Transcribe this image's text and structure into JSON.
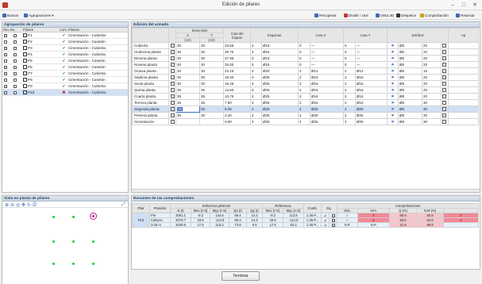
{
  "window": {
    "title": "Edición de pilares",
    "min": "–",
    "max": "□",
    "close": "✕"
  },
  "toolbar": {
    "left": [
      {
        "label": "Buscar",
        "icon": "binoculars-icon",
        "color": "#3d6bb3"
      },
      {
        "label": "Agrupaciones ▾",
        "icon": "group-icon",
        "color": "#3d6bb3"
      }
    ],
    "right": [
      {
        "label": "Recuperar",
        "icon": "undo-icon",
        "color": "#3d6bb3"
      },
      {
        "label": "Dividir / Unir",
        "icon": "split-icon",
        "color": "#c0392b"
      },
      {
        "label": "Vista 3D",
        "icon": "cube-icon",
        "color": "#3d6bb3"
      },
      {
        "label": "Despiece",
        "icon": "grid-icon",
        "color": "#333333"
      },
      {
        "label": "Comprobación",
        "icon": "check-icon",
        "color": "#d4a017"
      },
      {
        "label": "Rearmar",
        "icon": "wrench-icon",
        "color": "#3d6bb3"
      }
    ]
  },
  "groups": {
    "title": "Agrupación de pilares",
    "headers": [
      "Rev.",
      "Bo.",
      "Pilares",
      "Com.",
      "Plantas"
    ],
    "rows": [
      {
        "name": "P1",
        "status": "ok",
        "plantas": "Cimentación - Cubierta"
      },
      {
        "name": "P2",
        "status": "ok",
        "plantas": "Cimentación - Casetón"
      },
      {
        "name": "P3",
        "status": "ok",
        "plantas": "Cimentación - Cubierta"
      },
      {
        "name": "P4",
        "status": "ok",
        "plantas": "Cimentación - Cubierta"
      },
      {
        "name": "P5",
        "status": "ok",
        "plantas": "Cimentación - Casetón"
      },
      {
        "name": "P6",
        "status": "ok",
        "plantas": "Cimentación - Casetón"
      },
      {
        "name": "P7",
        "status": "ok",
        "plantas": "Cimentación - Cubierta"
      },
      {
        "name": "P8",
        "status": "ok",
        "plantas": "Cimentación - Casetón"
      },
      {
        "name": "P9",
        "status": "ok",
        "plantas": "Cimentación - Cubierta"
      },
      {
        "name": "P10",
        "status": "err",
        "plantas": "Cimentación - Cubierta"
      }
    ]
  },
  "edicion": {
    "title": "Edición del armado",
    "h_dimension": "Dimensión",
    "h_x": "X",
    "h_y": "Y",
    "h_cm": "(cm)",
    "h_cota": "Cota del",
    "h_cota2": "forjado",
    "h_esquinas": "Esquinas",
    "h_carax": "Cara X",
    "h_caray": "Cara Y",
    "h_estribos": "Estribos",
    "h_ap": "Ap",
    "rows": [
      {
        "planta": "Cubierta",
        "x": "30",
        "y": "30",
        "cota": "33.55",
        "eq": "4",
        "eqd": "Ø16",
        "cxn": "0",
        "cxd": "—",
        "cyn": "0",
        "cyd": "—",
        "est": "Ø6",
        "sep": "20",
        "sel": false
      },
      {
        "planta": "Undécima planta",
        "x": "30",
        "y": "30",
        "cota": "30.70",
        "eq": "4",
        "eqd": "Ø16",
        "cxn": "0",
        "cxd": "—",
        "cyn": "0",
        "cyd": "—",
        "est": "Ø6",
        "sep": "20",
        "sel": false
      },
      {
        "planta": "Décima planta",
        "x": "30",
        "y": "30",
        "cota": "27.85",
        "eq": "4",
        "eqd": "Ø16",
        "cxn": "0",
        "cxd": "—",
        "cyn": "0",
        "cyd": "—",
        "est": "Ø6",
        "sep": "20",
        "sel": false
      },
      {
        "planta": "Novena planta",
        "x": "30",
        "y": "30",
        "cota": "25.00",
        "eq": "4",
        "eqd": "Ø16",
        "cxn": "0",
        "cxd": "—",
        "cyn": "0",
        "cyd": "—",
        "est": "Ø6",
        "sep": "20",
        "sel": false
      },
      {
        "planta": "Octava planta",
        "x": "30",
        "y": "30",
        "cota": "22.15",
        "eq": "4",
        "eqd": "Ø20",
        "cxn": "2",
        "cxd": "Ø12",
        "cyn": "2",
        "cyd": "Ø12",
        "est": "Ø6",
        "sep": "15",
        "sel": false
      },
      {
        "planta": "Séptima planta",
        "x": "30",
        "y": "30",
        "cota": "19.30",
        "eq": "4",
        "eqd": "Ø25",
        "cxn": "2",
        "cxd": "Ø16",
        "cyn": "2",
        "cyd": "Ø16",
        "est": "Ø8",
        "sep": "20",
        "sel": false
      },
      {
        "planta": "Sexta planta",
        "x": "30",
        "y": "30",
        "cota": "16.45",
        "eq": "4",
        "eqd": "Ø25",
        "cxn": "2",
        "cxd": "Ø16",
        "cyn": "2",
        "cyd": "Ø16",
        "est": "Ø8",
        "sep": "20",
        "sel": false
      },
      {
        "planta": "Quinta planta",
        "x": "35",
        "y": "35",
        "cota": "13.60",
        "eq": "4",
        "eqd": "Ø25",
        "cxn": "2",
        "cxd": "Ø16",
        "cyn": "2",
        "cyd": "Ø16",
        "est": "Ø8",
        "sep": "20",
        "sel": false
      },
      {
        "planta": "Cuarta planta",
        "x": "35",
        "y": "35",
        "cota": "10.75",
        "eq": "4",
        "eqd": "Ø25",
        "cxn": "2",
        "cxd": "Ø16",
        "cyn": "2",
        "cyd": "Ø16",
        "est": "Ø8",
        "sep": "20",
        "sel": false
      },
      {
        "planta": "Tercera planta",
        "x": "35",
        "y": "35",
        "cota": "7.90",
        "eq": "4",
        "eqd": "Ø25",
        "cxn": "2",
        "cxd": "Ø16",
        "cyn": "2",
        "cyd": "Ø16",
        "est": "Ø8",
        "sep": "30",
        "sel": false
      },
      {
        "planta": "Segunda planta",
        "x": "35",
        "y": "35",
        "cota": "5.05",
        "eq": "4",
        "eqd": "Ø25",
        "cxn": "4",
        "cxd": "Ø25",
        "cyn": "4",
        "cyd": "Ø25",
        "est": "Ø8",
        "sep": "30",
        "sel": true
      },
      {
        "planta": "Primera planta",
        "x": "30",
        "y": "35",
        "cota": "2.20",
        "eq": "4",
        "eqd": "Ø25",
        "cxn": "4",
        "cxd": "Ø25",
        "cyn": "4",
        "cyd": "Ø25",
        "est": "Ø8",
        "sep": "30",
        "sel": false
      },
      {
        "planta": "Cimentación",
        "x": "",
        "y": "",
        "cota": "0.90",
        "eq": "4",
        "eqd": "Ø25",
        "cxn": "4",
        "cxd": "Ø25",
        "cyn": "4",
        "cyd": "Ø25",
        "est": "Ø8",
        "sep": "30",
        "sel": false
      }
    ]
  },
  "vista": {
    "title": "Vista en planta de pilares",
    "tools": [
      "zoom-in-icon",
      "zoom-out-icon",
      "zoom-window-icon",
      "pan-icon",
      "rotate-icon",
      "print-icon",
      "fit-icon"
    ]
  },
  "resumen": {
    "title": "Resumen de las comprobaciones",
    "h_esf": "Esfuerzos pésimos",
    "h_ref": "Referencia",
    "h_comp": "Comprobaciones",
    "cols": [
      "Pilar",
      "Posición",
      "N (t)",
      "Mxx (t·m)",
      "Myy (t·m)",
      "Qx (t)",
      "Qy (t)",
      "Mxx (t·m)",
      "Myy (t·m)",
      "Comb.",
      "Eq.",
      "Dist.",
      "Arm.",
      "Q (%)",
      "N,M (%)"
    ],
    "pilar": "P10",
    "rows": [
      {
        "pos": "Pie",
        "n": "2081.1",
        "mx": "-8.2",
        "my": "144.6",
        "qx": "89.4",
        "qy": "14.3",
        "rmx": "-8.2",
        "rmy": "113.8",
        "comb": "1.35·P...",
        "dist": "✓",
        "arm": "✗",
        "q": "60.5",
        "nm": "83.9"
      },
      {
        "pos": "Cabeza",
        "n": "2070.7",
        "mx": "33.8",
        "my": "-114.9",
        "qx": "89.4",
        "qy": "14.3",
        "rmx": "33.8",
        "rmy": "-114.0",
        "comb": "1.35·P...",
        "dist": "✓",
        "arm": "✗",
        "q": "60.5",
        "nm": "84.6"
      },
      {
        "pos": "3.05 m",
        "n": "2039.8",
        "mx": "17.5",
        "my": "115.3",
        "qx": "73.8",
        "qy": "9.9",
        "rmx": "17.5",
        "rmy": "63.3",
        "comb": "1.35·P...",
        "dist": "N.P.",
        "arm": "N.P.",
        "q": "21.8",
        "nm": "89.9"
      }
    ]
  },
  "footer": {
    "terminar": "Terminar"
  }
}
